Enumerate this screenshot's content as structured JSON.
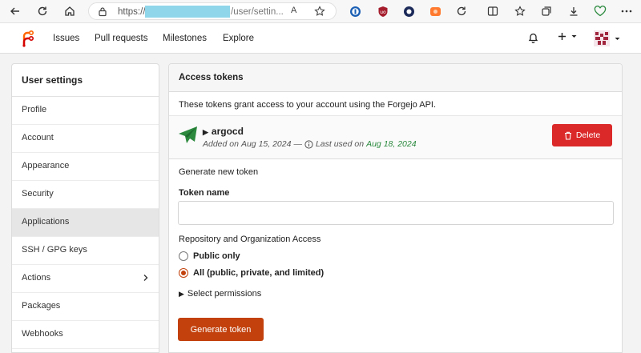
{
  "browser": {
    "url_protocol": "https://",
    "url_path": "/user/settin...",
    "read_aloud_label": "A"
  },
  "navbar": {
    "links": [
      "Issues",
      "Pull requests",
      "Milestones",
      "Explore"
    ]
  },
  "sidebar": {
    "title": "User settings",
    "items": [
      {
        "label": "Profile"
      },
      {
        "label": "Account"
      },
      {
        "label": "Appearance"
      },
      {
        "label": "Security"
      },
      {
        "label": "Applications",
        "active": true
      },
      {
        "label": "SSH / GPG keys"
      },
      {
        "label": "Actions",
        "has_chevron": true
      },
      {
        "label": "Packages"
      },
      {
        "label": "Webhooks"
      }
    ]
  },
  "main": {
    "title": "Access tokens",
    "description": "These tokens grant access to your account using the Forgejo API.",
    "token": {
      "name": "argocd",
      "added_prefix": "Added on",
      "added_date": "Aug 15, 2024",
      "separator": "—",
      "last_used_prefix": "Last used on",
      "last_used_date": "Aug 18, 2024",
      "delete_label": "Delete"
    },
    "new_token": {
      "heading": "Generate new token",
      "name_label": "Token name",
      "name_value": "",
      "access_label": "Repository and Organization Access",
      "options": [
        {
          "label": "Public only",
          "checked": false
        },
        {
          "label": "All (public, private, and limited)",
          "checked": true
        }
      ],
      "select_permissions": "Select permissions",
      "generate_label": "Generate token"
    }
  },
  "colors": {
    "accent": "#c2410c",
    "danger": "#db2828",
    "green": "#2b8a3e",
    "logo_orange": "#ff6600",
    "logo_red": "#d40000"
  }
}
